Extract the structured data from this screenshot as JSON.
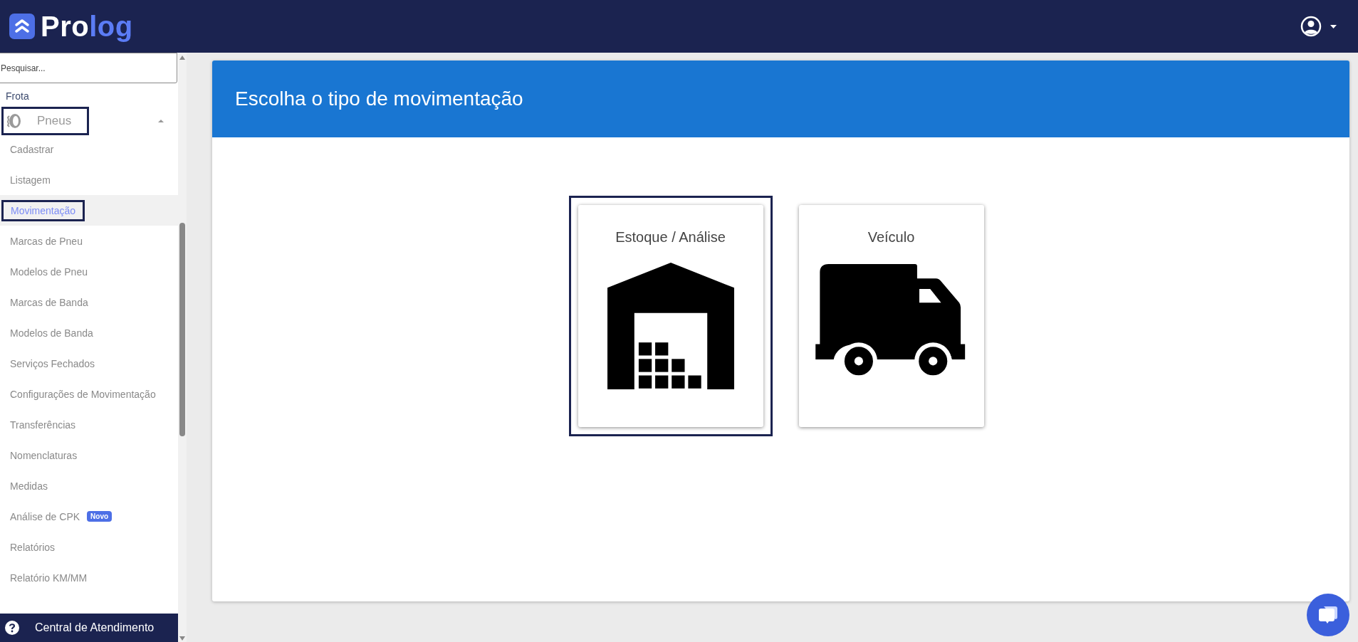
{
  "header": {
    "logo": {
      "part_1": "Pro",
      "part_2": "log"
    }
  },
  "sidebar": {
    "search": {
      "placeholder": "Pesquisar..."
    },
    "section": "Frota",
    "group": {
      "label": "Pneus",
      "expanded": true,
      "outlined": true
    },
    "items": [
      {
        "label": "Cadastrar",
        "selected": false
      },
      {
        "label": "Listagem",
        "selected": false
      },
      {
        "label": "Movimentação",
        "selected": true
      },
      {
        "label": "Marcas de Pneu",
        "selected": false
      },
      {
        "label": "Modelos de Pneu",
        "selected": false
      },
      {
        "label": "Marcas de Banda",
        "selected": false
      },
      {
        "label": "Modelos de Banda",
        "selected": false
      },
      {
        "label": "Serviços Fechados",
        "selected": false
      },
      {
        "label": "Configurações de Movimentação",
        "selected": false
      },
      {
        "label": "Transferências",
        "selected": false
      },
      {
        "label": "Nomenclaturas",
        "selected": false
      },
      {
        "label": "Medidas",
        "selected": false
      },
      {
        "label": "Análise de CPK",
        "selected": false,
        "badge": "Novo"
      },
      {
        "label": "Relatórios",
        "selected": false
      },
      {
        "label": "Relatório KM/MM",
        "selected": false
      }
    ],
    "help_bar": {
      "label": "Central de Atendimento"
    }
  },
  "panel": {
    "title": "Escolha o tipo de movimentação",
    "options": [
      {
        "label": "Estoque / Análise",
        "kind": "warehouse",
        "selected": true
      },
      {
        "label": "Veículo",
        "kind": "truck",
        "selected": false
      }
    ]
  }
}
